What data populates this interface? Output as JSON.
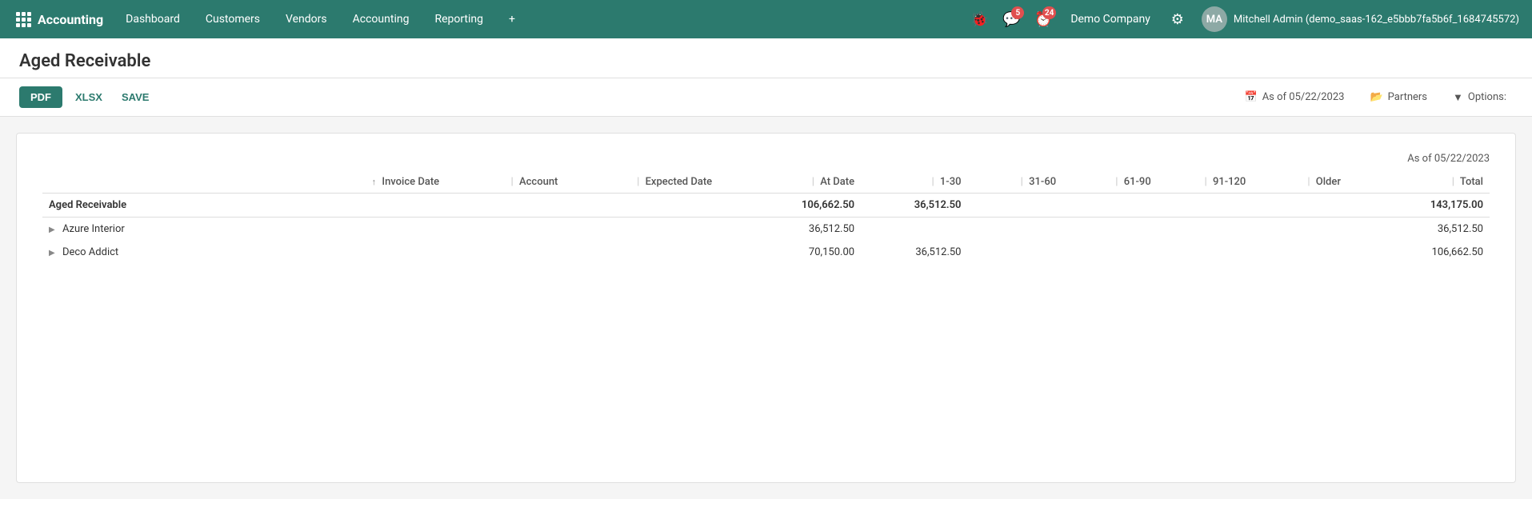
{
  "app": {
    "logo_label": "Accounting",
    "grid_icon": "grid"
  },
  "topnav": {
    "items": [
      {
        "id": "dashboard",
        "label": "Dashboard"
      },
      {
        "id": "customers",
        "label": "Customers"
      },
      {
        "id": "vendors",
        "label": "Vendors"
      },
      {
        "id": "accounting",
        "label": "Accounting"
      },
      {
        "id": "reporting",
        "label": "Reporting"
      }
    ],
    "add_label": "+",
    "bug_icon": "🐞",
    "chat_icon": "💬",
    "chat_badge": "5",
    "clock_icon": "⏰",
    "clock_badge": "24",
    "company": "Demo Company",
    "settings_icon": "⚙",
    "user_name": "Mitchell Admin (demo_saas-162_e5bbb7fa5b6f_1684745572)",
    "user_initials": "MA"
  },
  "page": {
    "title": "Aged Receivable"
  },
  "toolbar": {
    "pdf_label": "PDF",
    "xlsx_label": "XLSX",
    "save_label": "SAVE",
    "as_of_label": "As of 05/22/2023",
    "partners_label": "Partners",
    "options_label": "Options:"
  },
  "report": {
    "date_header": "As of 05/22/2023",
    "columns": {
      "name": "",
      "invoice_date": "Invoice Date",
      "account": "Account",
      "expected_date": "Expected Date",
      "at_date": "At Date",
      "range_1_30": "1-30",
      "range_31_60": "31-60",
      "range_61_90": "61-90",
      "range_91_120": "91-120",
      "older": "Older",
      "total": "Total"
    },
    "summary_row": {
      "name": "Aged Receivable",
      "at_date": "106,662.50",
      "range_1_30": "36,512.50",
      "total": "143,175.00"
    },
    "rows": [
      {
        "name": "Azure Interior",
        "at_date": "36,512.50",
        "range_1_30": "",
        "total": "36,512.50"
      },
      {
        "name": "Deco Addict",
        "at_date": "70,150.00",
        "range_1_30": "36,512.50",
        "total": "106,662.50"
      }
    ]
  }
}
